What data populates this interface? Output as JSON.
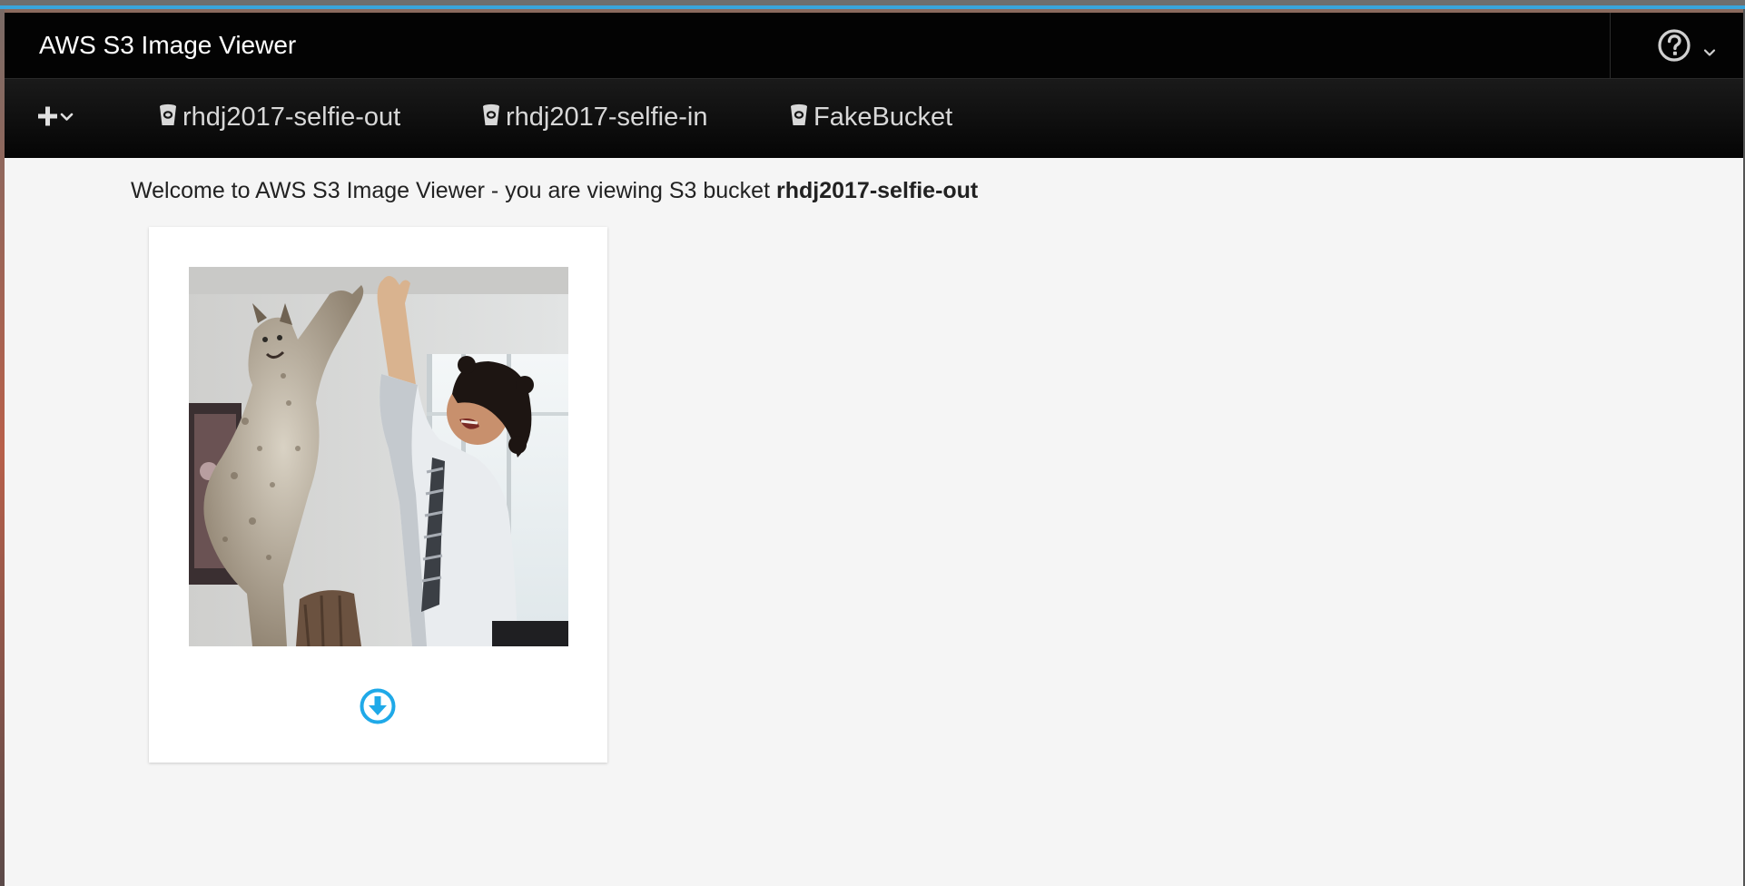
{
  "app": {
    "title": "AWS S3 Image Viewer"
  },
  "header": {
    "help_icon": "question-circle-icon",
    "help_caret_icon": "chevron-down-icon"
  },
  "navbar": {
    "add_icon": "plus-icon",
    "add_caret_icon": "chevron-down-icon",
    "bucket_icon": "bucket-icon",
    "buckets": [
      {
        "label": "rhdj2017-selfie-out"
      },
      {
        "label": "rhdj2017-selfie-in"
      },
      {
        "label": "FakeBucket"
      }
    ]
  },
  "main": {
    "welcome_prefix": "Welcome to AWS S3 Image Viewer - you are viewing S3 bucket",
    "current_bucket": "rhdj2017-selfie-out"
  },
  "gallery": {
    "items": [
      {
        "download_icon": "arrow-circle-down-icon"
      }
    ]
  },
  "colors": {
    "header_bg": "#030303",
    "accent_blue": "#39a5dc",
    "download_blue": "#1fa9e8",
    "page_bg": "#f5f5f5"
  }
}
